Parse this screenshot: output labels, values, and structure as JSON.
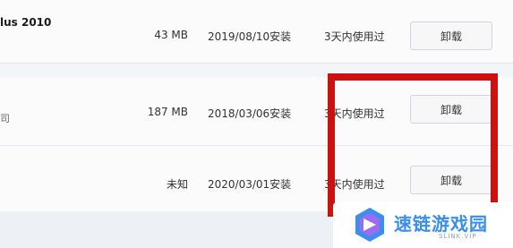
{
  "rows": [
    {
      "name": "lus 2010",
      "sub": "",
      "size": "43 MB",
      "date": "2019/08/10安装",
      "used": "3天内使用过",
      "action": "卸载"
    },
    {
      "name": "",
      "sub": "司",
      "size": "187 MB",
      "date": "2018/03/06安装",
      "used": "3天内使用过",
      "action": "卸载"
    },
    {
      "name": "",
      "sub": "",
      "size": "未知",
      "date": "2020/03/01安装",
      "used": "3天内使用过",
      "action": "卸载"
    }
  ],
  "watermark": {
    "title": "速链游戏园",
    "subtitle": "SLINK.VIP"
  },
  "colors": {
    "highlight": "#cc1111",
    "brand": "#3a8ef0"
  }
}
